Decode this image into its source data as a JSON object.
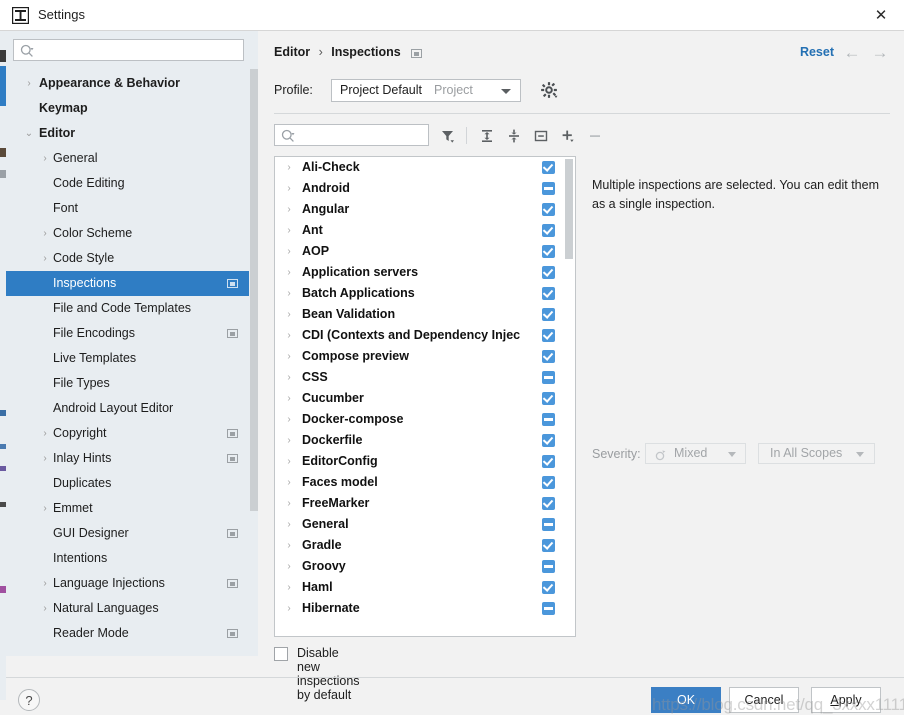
{
  "window": {
    "title": "Settings",
    "app_icon": "intellij-idea-icon",
    "close_label": "✕"
  },
  "sidebar": {
    "search": {
      "placeholder": "",
      "value": "",
      "icon": "search-icon"
    },
    "items": [
      {
        "label": "Appearance & Behavior",
        "level": 0,
        "arrow": "›",
        "badge": false,
        "selected": false
      },
      {
        "label": "Keymap",
        "level": 0,
        "arrow": "",
        "badge": false,
        "selected": false
      },
      {
        "label": "Editor",
        "level": 0,
        "arrow": "⌄",
        "badge": false,
        "selected": false
      },
      {
        "label": "General",
        "level": 1,
        "arrow": "›",
        "badge": false,
        "selected": false
      },
      {
        "label": "Code Editing",
        "level": 1,
        "arrow": "",
        "badge": false,
        "selected": false
      },
      {
        "label": "Font",
        "level": 1,
        "arrow": "",
        "badge": false,
        "selected": false
      },
      {
        "label": "Color Scheme",
        "level": 1,
        "arrow": "›",
        "badge": false,
        "selected": false
      },
      {
        "label": "Code Style",
        "level": 1,
        "arrow": "›",
        "badge": false,
        "selected": false
      },
      {
        "label": "Inspections",
        "level": 1,
        "arrow": "",
        "badge": true,
        "selected": true
      },
      {
        "label": "File and Code Templates",
        "level": 1,
        "arrow": "",
        "badge": false,
        "selected": false
      },
      {
        "label": "File Encodings",
        "level": 1,
        "arrow": "",
        "badge": true,
        "selected": false
      },
      {
        "label": "Live Templates",
        "level": 1,
        "arrow": "",
        "badge": false,
        "selected": false
      },
      {
        "label": "File Types",
        "level": 1,
        "arrow": "",
        "badge": false,
        "selected": false
      },
      {
        "label": "Android Layout Editor",
        "level": 1,
        "arrow": "",
        "badge": false,
        "selected": false
      },
      {
        "label": "Copyright",
        "level": 1,
        "arrow": "›",
        "badge": true,
        "selected": false
      },
      {
        "label": "Inlay Hints",
        "level": 1,
        "arrow": "›",
        "badge": true,
        "selected": false
      },
      {
        "label": "Duplicates",
        "level": 1,
        "arrow": "",
        "badge": false,
        "selected": false
      },
      {
        "label": "Emmet",
        "level": 1,
        "arrow": "›",
        "badge": false,
        "selected": false
      },
      {
        "label": "GUI Designer",
        "level": 1,
        "arrow": "",
        "badge": true,
        "selected": false
      },
      {
        "label": "Intentions",
        "level": 1,
        "arrow": "",
        "badge": false,
        "selected": false
      },
      {
        "label": "Language Injections",
        "level": 1,
        "arrow": "›",
        "badge": true,
        "selected": false
      },
      {
        "label": "Natural Languages",
        "level": 1,
        "arrow": "›",
        "badge": false,
        "selected": false
      },
      {
        "label": "Reader Mode",
        "level": 1,
        "arrow": "",
        "badge": true,
        "selected": false
      }
    ]
  },
  "header": {
    "breadcrumb_root": "Editor",
    "breadcrumb_sep": "›",
    "breadcrumb_leaf": "Inspections",
    "reset_label": "Reset",
    "back_icon": "←",
    "forward_icon": "→"
  },
  "profile": {
    "label": "Profile:",
    "value": "Project Default",
    "scope": "Project",
    "gear_icon": "gear-icon"
  },
  "toolbar": {
    "search": {
      "placeholder": "",
      "value": "",
      "icon": "search-icon"
    },
    "buttons": [
      {
        "name": "filter-icon",
        "title": "Filter"
      },
      {
        "name": "expand-all-icon",
        "title": "Expand All"
      },
      {
        "name": "collapse-all-icon",
        "title": "Collapse All"
      },
      {
        "name": "group-by-icon",
        "title": "Group"
      },
      {
        "name": "add-icon",
        "title": "Add"
      },
      {
        "name": "remove-icon",
        "title": "Remove"
      }
    ]
  },
  "inspections": {
    "rows": [
      {
        "label": "Ali-Check",
        "state": "checked"
      },
      {
        "label": "Android",
        "state": "partial"
      },
      {
        "label": "Angular",
        "state": "checked"
      },
      {
        "label": "Ant",
        "state": "checked"
      },
      {
        "label": "AOP",
        "state": "checked"
      },
      {
        "label": "Application servers",
        "state": "checked"
      },
      {
        "label": "Batch Applications",
        "state": "checked"
      },
      {
        "label": "Bean Validation",
        "state": "checked"
      },
      {
        "label": "CDI (Contexts and Dependency Injec",
        "state": "checked"
      },
      {
        "label": "Compose preview",
        "state": "checked"
      },
      {
        "label": "CSS",
        "state": "partial"
      },
      {
        "label": "Cucumber",
        "state": "checked"
      },
      {
        "label": "Docker-compose",
        "state": "partial"
      },
      {
        "label": "Dockerfile",
        "state": "checked"
      },
      {
        "label": "EditorConfig",
        "state": "checked"
      },
      {
        "label": "Faces model",
        "state": "checked"
      },
      {
        "label": "FreeMarker",
        "state": "checked"
      },
      {
        "label": "General",
        "state": "partial"
      },
      {
        "label": "Gradle",
        "state": "checked"
      },
      {
        "label": "Groovy",
        "state": "partial"
      },
      {
        "label": "Haml",
        "state": "checked"
      },
      {
        "label": "Hibernate",
        "state": "partial"
      }
    ],
    "row_arrow": "›"
  },
  "details": {
    "description": "Multiple inspections are selected. You can edit them as a single inspection.",
    "severity_label": "Severity:",
    "severity_value": "Mixed",
    "scope_value": "In All Scopes"
  },
  "options": {
    "disable_new_label": "Disable new inspections by default",
    "disable_new_checked": false
  },
  "footer": {
    "help_label": "?",
    "ok_label": "OK",
    "cancel_label": "Cancel",
    "apply_label": "Apply",
    "apply_prefix": "A",
    "apply_suffix": "pply"
  },
  "watermark": {
    "text": "https://blog.csdn.net/qq_3xxxx1111"
  },
  "colors": {
    "accent": "#2f7dc4",
    "checkbox": "#4b97db",
    "link": "#2470b3",
    "sidebar_bg": "#e8edf1",
    "panel_bg": "#f2f2f2"
  }
}
